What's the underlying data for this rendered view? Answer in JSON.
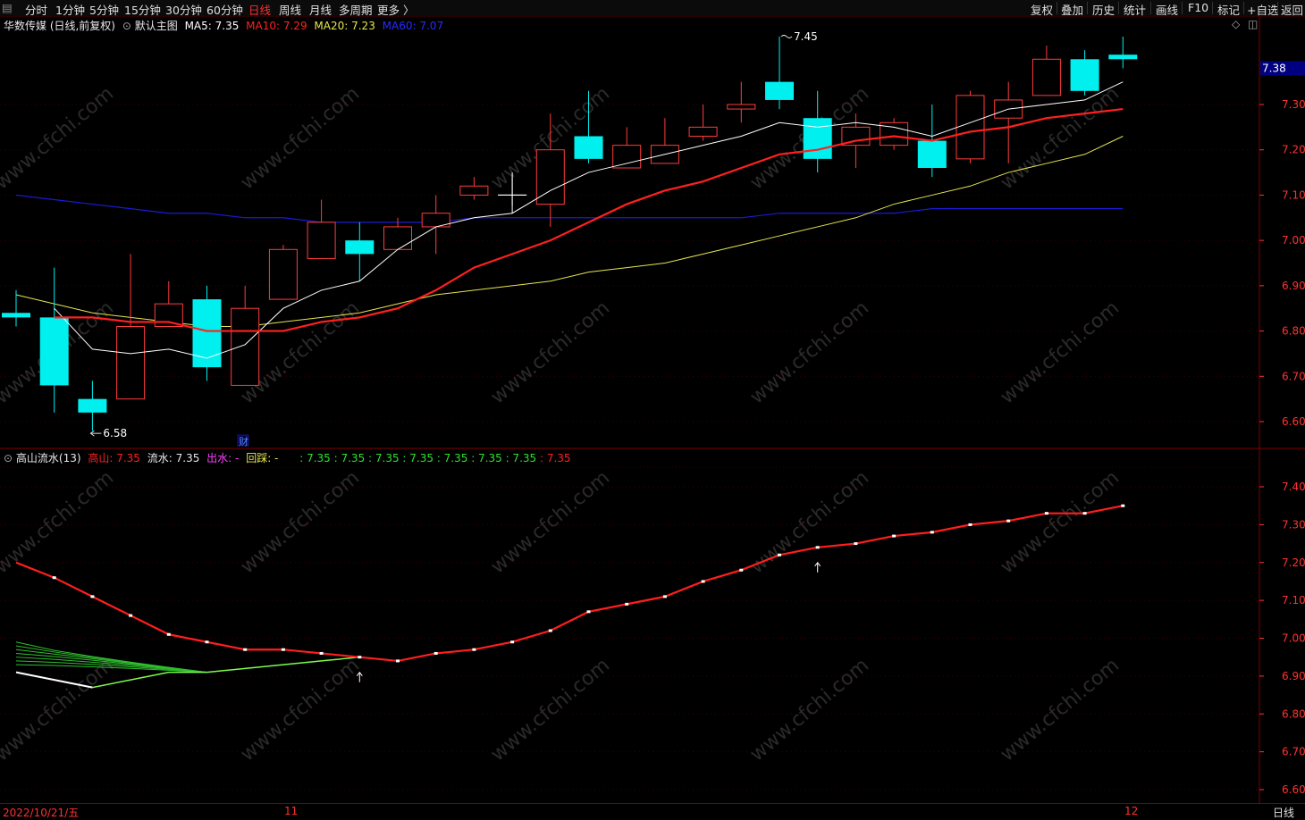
{
  "toolbar": {
    "periods": [
      "分时",
      "1分钟",
      "5分钟",
      "15分钟",
      "30分钟",
      "60分钟",
      "日线",
      "周线",
      "月线",
      "多周期",
      "更多 〉"
    ],
    "active_index": 6,
    "right": [
      "复权",
      "叠加",
      "历史",
      "统计",
      "画线",
      "F10",
      "标记",
      "+自选",
      "返回"
    ]
  },
  "main_legend": {
    "name": "华数传媒 (日线,前复权)",
    "indicator": "默认主图",
    "ma5": "MA5: 7.35",
    "ma10": "MA10: 7.29",
    "ma20": "MA20: 7.23",
    "ma60": "MA60: 7.07"
  },
  "sub_legend": {
    "name": "高山流水(13)",
    "gaoshan": "高山: 7.35",
    "liushui": "流水: 7.35",
    "chushui": "出水: -",
    "huicai": "回踩: -",
    "extra_green": ": 7.35 : 7.35 : 7.35 : 7.35 : 7.35 : 7.35 : 7.35",
    "extra_red": ": 7.35"
  },
  "annotations": {
    "high": "7.45",
    "low": "6.58",
    "cai": "财",
    "price_tag": "7.38"
  },
  "watermark": "www.cfchi.com",
  "bottom": {
    "date": "2022/10/21/五",
    "month1": "11",
    "month2": "12",
    "period": "日线"
  },
  "colors": {
    "up": "#ff3c3c",
    "down": "#00f0f0",
    "ma5": "#ffffff",
    "ma10": "#ff2020",
    "ma20": "#e6e650",
    "ma60": "#1a1ad8",
    "axis": "#ff3232",
    "border": "#800000"
  },
  "chart_data": [
    {
      "type": "candlestick",
      "ylim": [
        6.55,
        7.48
      ],
      "y_ticks": [
        "7.30",
        "7.20",
        "7.10",
        "7.00",
        "6.90",
        "6.80",
        "6.70",
        "6.60"
      ],
      "candles": [
        {
          "o": 6.84,
          "c": 6.83,
          "h": 6.89,
          "l": 6.81
        },
        {
          "o": 6.83,
          "c": 6.68,
          "h": 6.94,
          "l": 6.62
        },
        {
          "o": 6.65,
          "c": 6.62,
          "h": 6.69,
          "l": 6.58
        },
        {
          "o": 6.65,
          "c": 6.81,
          "h": 6.97,
          "l": 6.65
        },
        {
          "o": 6.81,
          "c": 6.86,
          "h": 6.91,
          "l": 6.81
        },
        {
          "o": 6.87,
          "c": 6.72,
          "h": 6.9,
          "l": 6.69
        },
        {
          "o": 6.68,
          "c": 6.85,
          "h": 6.9,
          "l": 6.68
        },
        {
          "o": 6.87,
          "c": 6.98,
          "h": 6.99,
          "l": 6.87
        },
        {
          "o": 6.96,
          "c": 7.04,
          "h": 7.09,
          "l": 6.96
        },
        {
          "o": 7.0,
          "c": 6.97,
          "h": 7.04,
          "l": 6.91
        },
        {
          "o": 6.98,
          "c": 7.03,
          "h": 7.05,
          "l": 6.98
        },
        {
          "o": 7.03,
          "c": 7.06,
          "h": 7.1,
          "l": 6.97
        },
        {
          "o": 7.1,
          "c": 7.12,
          "h": 7.14,
          "l": 7.09
        },
        {
          "o": 7.1,
          "c": 7.1,
          "h": 7.15,
          "l": 7.06
        },
        {
          "o": 7.08,
          "c": 7.2,
          "h": 7.28,
          "l": 7.03
        },
        {
          "o": 7.23,
          "c": 7.18,
          "h": 7.33,
          "l": 7.17
        },
        {
          "o": 7.16,
          "c": 7.21,
          "h": 7.25,
          "l": 7.16
        },
        {
          "o": 7.17,
          "c": 7.21,
          "h": 7.27,
          "l": 7.17
        },
        {
          "o": 7.23,
          "c": 7.25,
          "h": 7.3,
          "l": 7.22
        },
        {
          "o": 7.29,
          "c": 7.3,
          "h": 7.35,
          "l": 7.26
        },
        {
          "o": 7.35,
          "c": 7.31,
          "h": 7.45,
          "l": 7.29
        },
        {
          "o": 7.27,
          "c": 7.18,
          "h": 7.33,
          "l": 7.15
        },
        {
          "o": 7.21,
          "c": 7.25,
          "h": 7.28,
          "l": 7.16
        },
        {
          "o": 7.21,
          "c": 7.26,
          "h": 7.27,
          "l": 7.2
        },
        {
          "o": 7.22,
          "c": 7.16,
          "h": 7.3,
          "l": 7.14
        },
        {
          "o": 7.18,
          "c": 7.32,
          "h": 7.33,
          "l": 7.17
        },
        {
          "o": 7.27,
          "c": 7.31,
          "h": 7.35,
          "l": 7.17
        },
        {
          "o": 7.32,
          "c": 7.4,
          "h": 7.43,
          "l": 7.32
        },
        {
          "o": 7.4,
          "c": 7.33,
          "h": 7.42,
          "l": 7.32
        },
        {
          "o": 7.41,
          "c": 7.4,
          "h": 7.45,
          "l": 7.38
        }
      ],
      "ma5": [
        null,
        6.85,
        6.76,
        6.75,
        6.76,
        6.74,
        6.77,
        6.85,
        6.89,
        6.91,
        6.98,
        7.03,
        7.05,
        7.06,
        7.11,
        7.15,
        7.17,
        7.19,
        7.21,
        7.23,
        7.26,
        7.25,
        7.26,
        7.25,
        7.23,
        7.26,
        7.29,
        7.3,
        7.31,
        7.35
      ],
      "ma10": [
        null,
        6.83,
        6.83,
        6.82,
        6.82,
        6.8,
        6.8,
        6.8,
        6.82,
        6.83,
        6.85,
        6.89,
        6.94,
        6.97,
        7.0,
        7.04,
        7.08,
        7.11,
        7.13,
        7.16,
        7.19,
        7.2,
        7.22,
        7.23,
        7.22,
        7.24,
        7.25,
        7.27,
        7.28,
        7.29
      ],
      "ma20": [
        6.88,
        6.86,
        6.84,
        6.83,
        6.82,
        6.81,
        6.81,
        6.82,
        6.83,
        6.84,
        6.86,
        6.88,
        6.89,
        6.9,
        6.91,
        6.93,
        6.94,
        6.95,
        6.97,
        6.99,
        7.01,
        7.03,
        7.05,
        7.08,
        7.1,
        7.12,
        7.15,
        7.17,
        7.19,
        7.23
      ],
      "ma60": [
        7.1,
        7.09,
        7.08,
        7.07,
        7.06,
        7.06,
        7.05,
        7.05,
        7.04,
        7.04,
        7.04,
        7.04,
        7.05,
        7.05,
        7.05,
        7.05,
        7.05,
        7.05,
        7.05,
        7.05,
        7.06,
        7.06,
        7.06,
        7.06,
        7.07,
        7.07,
        7.07,
        7.07,
        7.07,
        7.07
      ]
    },
    {
      "type": "line",
      "ylim": [
        6.58,
        7.44
      ],
      "y_ticks": [
        "7.40",
        "7.30",
        "7.20",
        "7.10",
        "7.00",
        "6.90",
        "6.80",
        "6.70",
        "6.60"
      ],
      "series": [
        {
          "name": "高山",
          "values": [
            7.2,
            7.16,
            7.11,
            7.06,
            7.01,
            6.99,
            6.97,
            6.97,
            6.96,
            6.95,
            6.94,
            6.96,
            6.97,
            6.99,
            7.02,
            7.07,
            7.09,
            7.11,
            7.15,
            7.18,
            7.22,
            7.24,
            7.25,
            7.27,
            7.28,
            7.3,
            7.31,
            7.33,
            7.33,
            7.35
          ]
        },
        {
          "name": "流水",
          "values": [
            6.91,
            6.89,
            6.87,
            6.89,
            6.91,
            6.91,
            6.92,
            6.93,
            6.94,
            6.95,
            6.94
          ]
        }
      ],
      "arrows_at": [
        9,
        21
      ]
    }
  ]
}
